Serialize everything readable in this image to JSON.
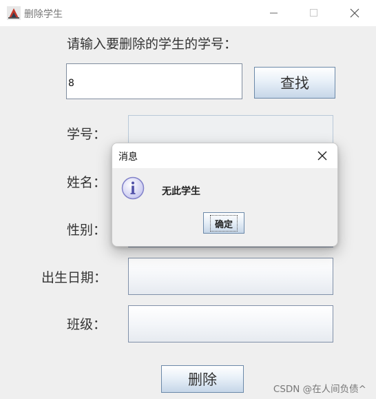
{
  "window": {
    "title": "删除学生"
  },
  "search": {
    "prompt": "请输入要删除的学生的学号：",
    "value": "8",
    "button_label": "查找"
  },
  "fields": [
    {
      "label": "学号："
    },
    {
      "label": "姓名："
    },
    {
      "label": "性别："
    },
    {
      "label": "出生日期："
    },
    {
      "label": "班级："
    }
  ],
  "delete_button_label": "删除",
  "watermark": "CSDN @在人间负债^",
  "dialog": {
    "title": "消息",
    "message": "无此学生",
    "ok_label": "确定",
    "icon": "info-icon"
  },
  "colors": {
    "button_gradient_bottom": "#c6d6e8",
    "info_icon": "#8080c8"
  }
}
